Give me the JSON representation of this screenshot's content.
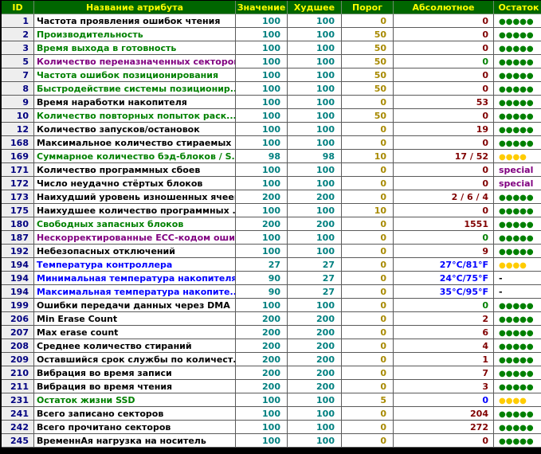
{
  "headers": {
    "id": "ID",
    "name": "Название атрибута",
    "value": "Значение",
    "worst": "Худшее",
    "threshold": "Порог",
    "absolute": "Абсолютное",
    "remaining": "Остаток"
  },
  "colors": {
    "header_bg": "#006600",
    "header_text": "#ffff00",
    "black": "#000000",
    "green": "#008000",
    "purple": "#800080",
    "blue": "#0000ff",
    "teal": "#008080",
    "olive": "#a88a00",
    "red": "#800000",
    "dots_ok": "#008000",
    "dots_warn": "#ffcc00"
  },
  "rows": [
    {
      "id": "1",
      "name": "Частота проявления ошибок чтения",
      "name_color": "black",
      "value": "100",
      "worst": "100",
      "threshold": "0",
      "absolute": "0",
      "abs_color": "red",
      "remaining": "●●●●●",
      "rem_kind": "ok"
    },
    {
      "id": "2",
      "name": "Производительность",
      "name_color": "green",
      "value": "100",
      "worst": "100",
      "threshold": "50",
      "absolute": "0",
      "abs_color": "red",
      "remaining": "●●●●●",
      "rem_kind": "ok"
    },
    {
      "id": "3",
      "name": "Время выхода в готовность",
      "name_color": "green",
      "value": "100",
      "worst": "100",
      "threshold": "50",
      "absolute": "0",
      "abs_color": "red",
      "remaining": "●●●●●",
      "rem_kind": "ok"
    },
    {
      "id": "5",
      "name": "Количество переназначенных секторов",
      "name_color": "purple",
      "value": "100",
      "worst": "100",
      "threshold": "50",
      "absolute": "0",
      "abs_color": "green",
      "remaining": "●●●●●",
      "rem_kind": "ok"
    },
    {
      "id": "7",
      "name": "Частота ошибок позиционирования",
      "name_color": "green",
      "value": "100",
      "worst": "100",
      "threshold": "50",
      "absolute": "0",
      "abs_color": "red",
      "remaining": "●●●●●",
      "rem_kind": "ok"
    },
    {
      "id": "8",
      "name": "Быстродействие системы позиционир...",
      "name_color": "green",
      "value": "100",
      "worst": "100",
      "threshold": "50",
      "absolute": "0",
      "abs_color": "red",
      "remaining": "●●●●●",
      "rem_kind": "ok"
    },
    {
      "id": "9",
      "name": "Время наработки накопителя",
      "name_color": "black",
      "value": "100",
      "worst": "100",
      "threshold": "0",
      "absolute": "53",
      "abs_color": "red",
      "remaining": "●●●●●",
      "rem_kind": "ok"
    },
    {
      "id": "10",
      "name": "Количество повторных попыток раск...",
      "name_color": "green",
      "value": "100",
      "worst": "100",
      "threshold": "50",
      "absolute": "0",
      "abs_color": "red",
      "remaining": "●●●●●",
      "rem_kind": "ok"
    },
    {
      "id": "12",
      "name": "Количество запусков/остановок",
      "name_color": "black",
      "value": "100",
      "worst": "100",
      "threshold": "0",
      "absolute": "19",
      "abs_color": "red",
      "remaining": "●●●●●",
      "rem_kind": "ok"
    },
    {
      "id": "168",
      "name": "Максимальное количество стираемых ...",
      "name_color": "black",
      "value": "100",
      "worst": "100",
      "threshold": "0",
      "absolute": "0",
      "abs_color": "red",
      "remaining": "●●●●●",
      "rem_kind": "ok"
    },
    {
      "id": "169",
      "name": "Суммарное количество бэд-блоков / S...",
      "name_color": "green",
      "value": "98",
      "worst": "98",
      "threshold": "10",
      "absolute": "17 / 52",
      "abs_color": "red",
      "remaining": "●●●●",
      "rem_kind": "warn"
    },
    {
      "id": "171",
      "name": "Количество программных сбоев",
      "name_color": "black",
      "value": "100",
      "worst": "100",
      "threshold": "0",
      "absolute": "0",
      "abs_color": "red",
      "remaining": "special",
      "rem_kind": "special"
    },
    {
      "id": "172",
      "name": "Число неудачно стёртых блоков",
      "name_color": "black",
      "value": "100",
      "worst": "100",
      "threshold": "0",
      "absolute": "0",
      "abs_color": "red",
      "remaining": "special",
      "rem_kind": "special"
    },
    {
      "id": "173",
      "name": "Наихудший уровень изношенных ячеек",
      "name_color": "black",
      "value": "200",
      "worst": "200",
      "threshold": "0",
      "absolute": "2 / 6 / 4",
      "abs_color": "red",
      "remaining": "●●●●●",
      "rem_kind": "ok"
    },
    {
      "id": "175",
      "name": "Наихудшее количество программных ...",
      "name_color": "black",
      "value": "100",
      "worst": "100",
      "threshold": "10",
      "absolute": "0",
      "abs_color": "red",
      "remaining": "●●●●●",
      "rem_kind": "ok"
    },
    {
      "id": "180",
      "name": "Свободных запасных блоков",
      "name_color": "green",
      "value": "200",
      "worst": "200",
      "threshold": "0",
      "absolute": "1551",
      "abs_color": "red",
      "remaining": "●●●●●",
      "rem_kind": "ok"
    },
    {
      "id": "187",
      "name": "Нескорректированные ECC-кодом оши...",
      "name_color": "purple",
      "value": "100",
      "worst": "100",
      "threshold": "0",
      "absolute": "0",
      "abs_color": "green",
      "remaining": "●●●●●",
      "rem_kind": "ok"
    },
    {
      "id": "192",
      "name": "Небезопасных отключений",
      "name_color": "black",
      "value": "100",
      "worst": "100",
      "threshold": "0",
      "absolute": "9",
      "abs_color": "red",
      "remaining": "●●●●●",
      "rem_kind": "ok"
    },
    {
      "id": "194",
      "name": "Температура контроллера",
      "name_color": "blue",
      "value": "27",
      "worst": "27",
      "threshold": "0",
      "absolute": "27°C/81°F",
      "abs_color": "blue",
      "remaining": "●●●●",
      "rem_kind": "warn"
    },
    {
      "id": "194",
      "name": "Минимальная температура накопителя",
      "name_color": "blue",
      "value": "90",
      "worst": "27",
      "threshold": "0",
      "absolute": "24°C/75°F",
      "abs_color": "blue",
      "remaining": "-",
      "rem_kind": "dash"
    },
    {
      "id": "194",
      "name": "Максимальная температура накопите...",
      "name_color": "blue",
      "value": "90",
      "worst": "27",
      "threshold": "0",
      "absolute": "35°C/95°F",
      "abs_color": "blue",
      "remaining": "-",
      "rem_kind": "dash"
    },
    {
      "id": "199",
      "name": "Ошибки передачи данных через DMA",
      "name_color": "black",
      "value": "100",
      "worst": "100",
      "threshold": "0",
      "absolute": "0",
      "abs_color": "green",
      "remaining": "●●●●●",
      "rem_kind": "ok"
    },
    {
      "id": "206",
      "name": "Min Erase Count",
      "name_color": "black",
      "value": "200",
      "worst": "200",
      "threshold": "0",
      "absolute": "2",
      "abs_color": "red",
      "remaining": "●●●●●",
      "rem_kind": "ok"
    },
    {
      "id": "207",
      "name": "Max erase count",
      "name_color": "black",
      "value": "200",
      "worst": "200",
      "threshold": "0",
      "absolute": "6",
      "abs_color": "red",
      "remaining": "●●●●●",
      "rem_kind": "ok"
    },
    {
      "id": "208",
      "name": "Среднее количество стираний",
      "name_color": "black",
      "value": "200",
      "worst": "200",
      "threshold": "0",
      "absolute": "4",
      "abs_color": "red",
      "remaining": "●●●●●",
      "rem_kind": "ok"
    },
    {
      "id": "209",
      "name": "Оставшийся срок службы по количест...",
      "name_color": "black",
      "value": "200",
      "worst": "200",
      "threshold": "0",
      "absolute": "1",
      "abs_color": "red",
      "remaining": "●●●●●",
      "rem_kind": "ok"
    },
    {
      "id": "210",
      "name": "Вибрация во время записи",
      "name_color": "black",
      "value": "200",
      "worst": "200",
      "threshold": "0",
      "absolute": "7",
      "abs_color": "red",
      "remaining": "●●●●●",
      "rem_kind": "ok"
    },
    {
      "id": "211",
      "name": "Вибрация во время чтения",
      "name_color": "black",
      "value": "200",
      "worst": "200",
      "threshold": "0",
      "absolute": "3",
      "abs_color": "red",
      "remaining": "●●●●●",
      "rem_kind": "ok"
    },
    {
      "id": "231",
      "name": "Остаток жизни SSD",
      "name_color": "green",
      "value": "100",
      "worst": "100",
      "threshold": "5",
      "absolute": "0",
      "abs_color": "blue",
      "remaining": "●●●●",
      "rem_kind": "warn"
    },
    {
      "id": "241",
      "name": "Всего записано секторов",
      "name_color": "black",
      "value": "100",
      "worst": "100",
      "threshold": "0",
      "absolute": "204",
      "abs_color": "red",
      "remaining": "●●●●●",
      "rem_kind": "ok"
    },
    {
      "id": "242",
      "name": "Всего прочитано секторов",
      "name_color": "black",
      "value": "100",
      "worst": "100",
      "threshold": "0",
      "absolute": "272",
      "abs_color": "red",
      "remaining": "●●●●●",
      "rem_kind": "ok"
    },
    {
      "id": "245",
      "name": "ВременнАя нагрузка на носитель",
      "name_color": "black",
      "value": "100",
      "worst": "100",
      "threshold": "0",
      "absolute": "0",
      "abs_color": "red",
      "remaining": "●●●●●",
      "rem_kind": "ok"
    }
  ]
}
